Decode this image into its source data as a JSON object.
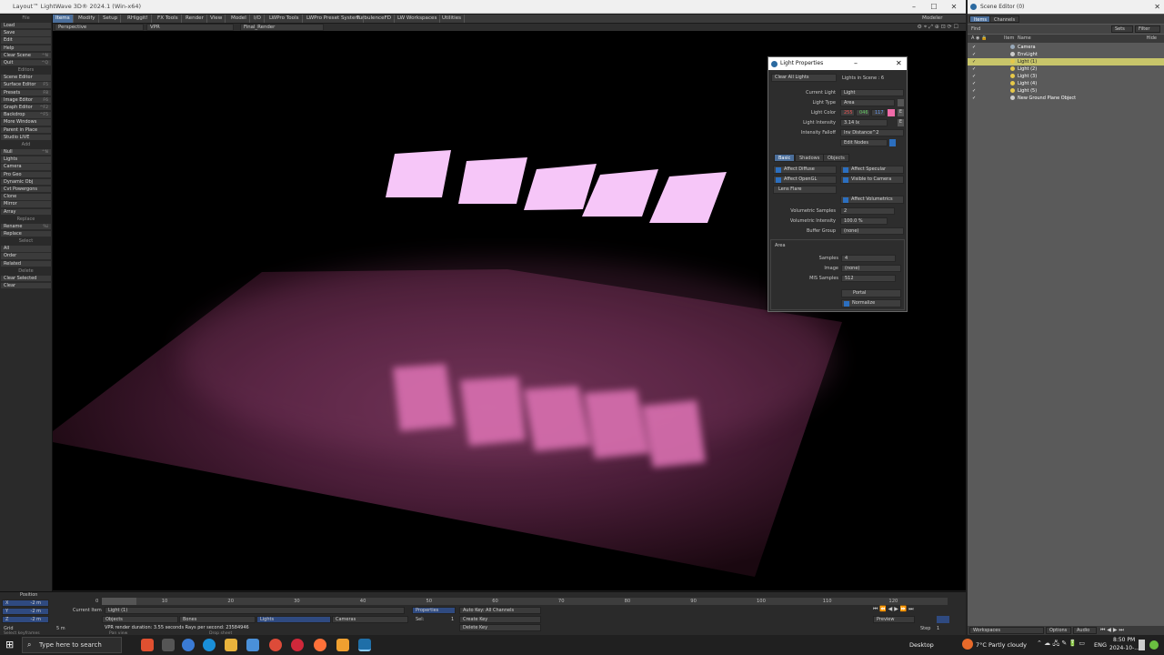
{
  "app": {
    "title": "Layout™ LightWave 3D® 2024.1 (Win-x64)",
    "modeler_label": "Modeler"
  },
  "menu": [
    "Items",
    "Modify",
    "Setup",
    "RHiggit!",
    "FX Tools",
    "Render",
    "View",
    "Model",
    "I/O",
    "LWPro Tools",
    "LWPro Preset System",
    "TurbulenceFD",
    "LW Workspaces",
    "Utilities"
  ],
  "viewport_bar": {
    "view": "Perspective",
    "vpr": "VPR",
    "render_mode": "Final_Render"
  },
  "toolbox": [
    {
      "label": "File",
      "type": "hdr"
    },
    {
      "label": "Load",
      "type": "tool",
      "key": ""
    },
    {
      "label": "Save",
      "type": "tool",
      "key": ""
    },
    {
      "label": "Edit",
      "type": "tool",
      "key": ""
    },
    {
      "label": "Help",
      "type": "tool",
      "key": ""
    },
    {
      "label": "Clear Scene",
      "type": "tool",
      "key": "^N"
    },
    {
      "label": "Quit",
      "type": "tool",
      "key": "^Q"
    },
    {
      "label": "Editors",
      "type": "hdr"
    },
    {
      "label": "Scene Editor",
      "type": "tool",
      "key": ""
    },
    {
      "label": "Surface Editor",
      "type": "tool",
      "key": "F5"
    },
    {
      "label": "Presets",
      "type": "tool",
      "key": "F8"
    },
    {
      "label": "Image Editor",
      "type": "tool",
      "key": "F6"
    },
    {
      "label": "Graph Editor",
      "type": "tool",
      "key": "^F2"
    },
    {
      "label": "Backdrop",
      "type": "tool",
      "key": "^F5"
    },
    {
      "label": "More Windows",
      "type": "tool",
      "key": ""
    },
    {
      "label": "Parent in Place",
      "type": "tool",
      "key": ""
    },
    {
      "label": "Studio LIVE",
      "type": "tool",
      "key": ""
    },
    {
      "label": "Add",
      "type": "hdr"
    },
    {
      "label": "Null",
      "type": "tool",
      "key": "^N"
    },
    {
      "label": "Lights",
      "type": "tool",
      "key": ""
    },
    {
      "label": "Camera",
      "type": "tool",
      "key": ""
    },
    {
      "label": "Pro Geo",
      "type": "tool",
      "key": ""
    },
    {
      "label": "Dynamic Obj",
      "type": "tool",
      "key": ""
    },
    {
      "label": "Cvt Powergons",
      "type": "tool",
      "key": ""
    },
    {
      "label": "Clone",
      "type": "tool",
      "key": ""
    },
    {
      "label": "Mirror",
      "type": "tool",
      "key": ""
    },
    {
      "label": "Array",
      "type": "tool",
      "key": ""
    },
    {
      "label": "Replace",
      "type": "hdr"
    },
    {
      "label": "Rename",
      "type": "tool",
      "key": "%i"
    },
    {
      "label": "Replace",
      "type": "tool",
      "key": ""
    },
    {
      "label": "Select",
      "type": "hdr"
    },
    {
      "label": "All",
      "type": "tool",
      "key": ""
    },
    {
      "label": "Order",
      "type": "tool",
      "key": ""
    },
    {
      "label": "Related",
      "type": "tool",
      "key": ""
    },
    {
      "label": "Delete",
      "type": "hdr"
    },
    {
      "label": "Clear Selected",
      "type": "tool",
      "key": ""
    },
    {
      "label": "Clear",
      "type": "tool",
      "key": ""
    }
  ],
  "timeline": {
    "position_label": "Position",
    "axes": [
      {
        "axis": "X",
        "value": "-2 m"
      },
      {
        "axis": "Y",
        "value": "-2 m"
      },
      {
        "axis": "Z",
        "value": "-2 m"
      }
    ],
    "grid_label": "Grid",
    "grid_value": "5 m",
    "ticks": [
      "0",
      "10",
      "20",
      "30",
      "40",
      "50",
      "60",
      "70",
      "80",
      "90",
      "100",
      "110",
      "120"
    ],
    "current_frame": "0",
    "end_frame": "120",
    "current_item_label": "Current Item",
    "current_item": "Light (1)",
    "objects": "Objects",
    "bones": "Bones",
    "lights": "Lights",
    "cameras": "Cameras",
    "properties": "Properties",
    "sel_label": "Sel:",
    "sel_value": "1",
    "autokey": "Auto Key: All Channels",
    "create_key": "Create Key",
    "delete_key": "Delete Key",
    "status": "VPR render duration: 3.55 seconds  Rays per second: 23584946",
    "preview": "Preview",
    "step_label": "Step",
    "step_value": "1",
    "hint1": "Select keyframes",
    "hint2": "Pan view",
    "hint3": "Drop sheet"
  },
  "dialog": {
    "title": "Light Properties",
    "clear_all": "Clear All Lights",
    "lights_in_scene": "Lights in Scene : 6",
    "current_light_label": "Current Light",
    "current_light": "Light",
    "light_type_label": "Light Type",
    "light_type": "Area",
    "light_color_label": "Light Color",
    "color_r": "255",
    "color_g": "046",
    "color_b": "117",
    "color_hex": "#f06ba8",
    "intensity_label": "Light Intensity",
    "intensity": "3.14 lx",
    "falloff_label": "Intensity Falloff",
    "falloff": "Inv Distance^2",
    "edit_nodes": "Edit Nodes",
    "tabs": [
      "Basic",
      "Shadows",
      "Objects"
    ],
    "affect_diffuse": "Affect Diffuse",
    "affect_specular": "Affect Specular",
    "affect_opengl": "Affect OpenGL",
    "visible_camera": "Visible to Camera",
    "lens_flare": "Lens Flare",
    "affect_volumetrics": "Affect Volumetrics",
    "vol_samples_label": "Volumetric Samples",
    "vol_samples": "2",
    "vol_intensity_label": "Volumetric Intensity",
    "vol_intensity": "100.0 %",
    "buffer_group_label": "Buffer Group",
    "buffer_group": "(none)",
    "area_label": "Area",
    "samples_label": "Samples",
    "samples": "4",
    "image_label": "Image",
    "image": "(none)",
    "mis_label": "MIS Samples",
    "mis": "512",
    "portal": "Portal",
    "normalize": "Normalize"
  },
  "scene_editor": {
    "title": "Scene Editor (0)",
    "tabs": [
      "Items",
      "Channels"
    ],
    "find": "Find",
    "sets": "Sets",
    "filter": "Filter",
    "hide": "Hide",
    "col_item": "Item",
    "col_name": "Name",
    "items": [
      "Camera",
      "EnvLight",
      "Light (1)",
      "Light (2)",
      "Light (3)",
      "Light (4)",
      "Light (5)",
      "New Ground Plane Object"
    ],
    "workspaces": "Workspaces",
    "options": "Options",
    "audio": "Audio"
  },
  "taskbar": {
    "search": "Type here to search",
    "desktop": "Desktop",
    "weather": "7°C  Partly cloudy",
    "lang": "ENG",
    "time": "8:50 PM",
    "date": "2024-10-..."
  }
}
